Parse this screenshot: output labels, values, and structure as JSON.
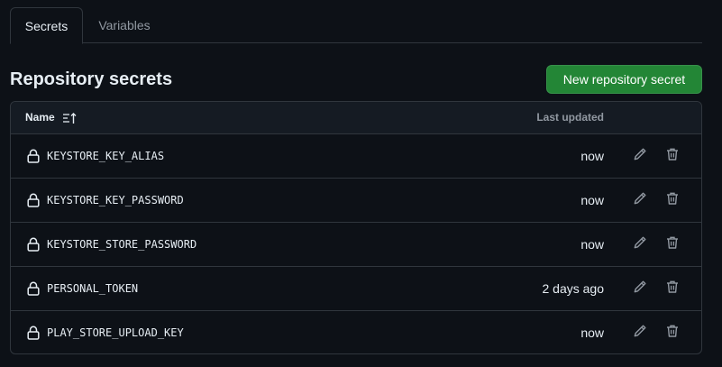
{
  "tabs": [
    {
      "label": "Secrets",
      "active": true
    },
    {
      "label": "Variables",
      "active": false
    }
  ],
  "section": {
    "title": "Repository secrets",
    "new_button_label": "New repository secret"
  },
  "table": {
    "col_name": "Name",
    "col_updated": "Last updated",
    "rows": [
      {
        "name": "KEYSTORE_KEY_ALIAS",
        "updated": "now"
      },
      {
        "name": "KEYSTORE_KEY_PASSWORD",
        "updated": "now"
      },
      {
        "name": "KEYSTORE_STORE_PASSWORD",
        "updated": "now"
      },
      {
        "name": "PERSONAL_TOKEN",
        "updated": "2 days ago"
      },
      {
        "name": "PLAY_STORE_UPLOAD_KEY",
        "updated": "now"
      }
    ]
  },
  "icons": {
    "row_icon": "lock-icon",
    "edit": "pencil-icon",
    "delete": "trash-icon",
    "sort": "sort-ascending-icon"
  },
  "colors": {
    "background": "#0d1117",
    "border": "#30363d",
    "primary_button": "#238636",
    "muted_text": "#9198a1",
    "text": "#e6edf3"
  }
}
